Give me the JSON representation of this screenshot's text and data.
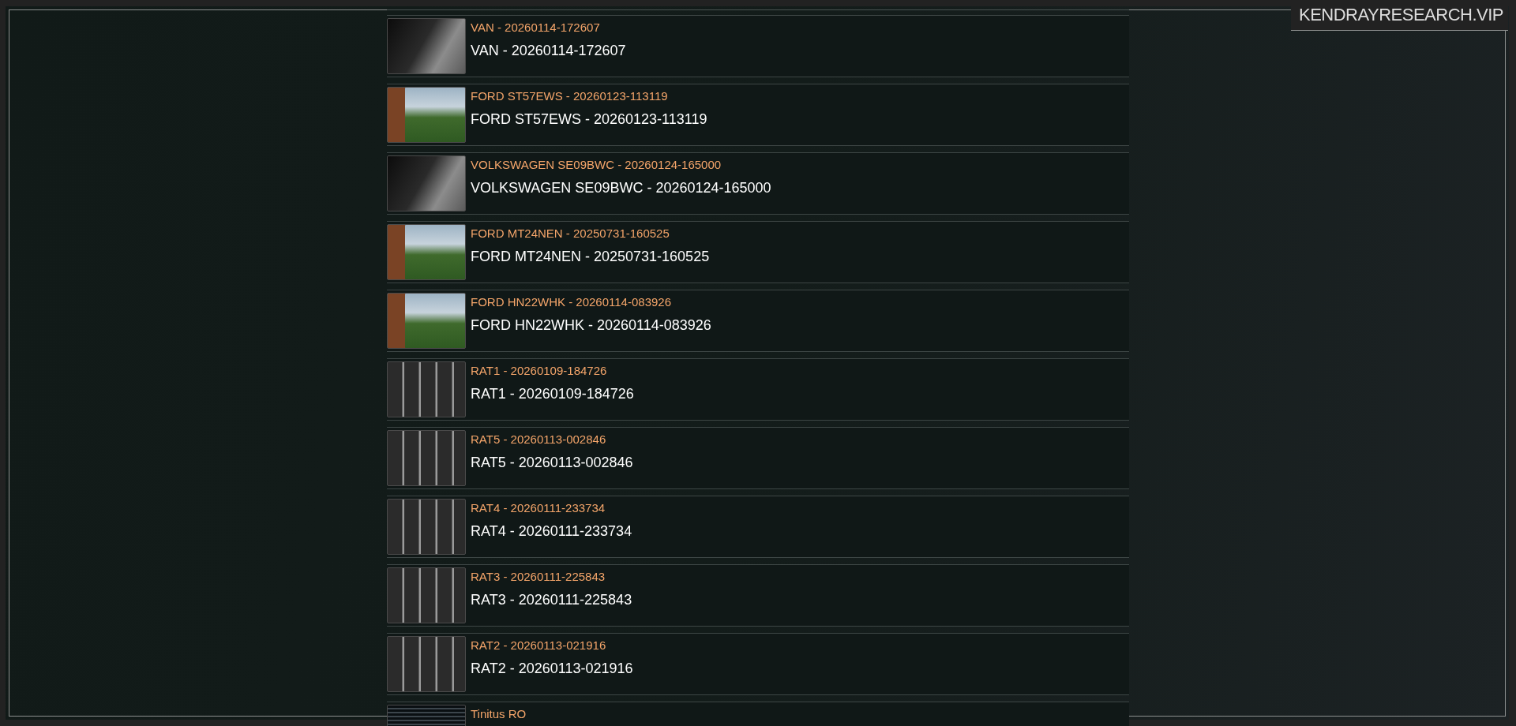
{
  "site_title": "KENDRAYRESEARCH.VIP",
  "recordings": [
    {
      "title": "VAN - 20260114-172607",
      "subtitle": "VAN - 20260114-172607",
      "kind": "night"
    },
    {
      "title": "FORD ST57EWS - 20260123-113119",
      "subtitle": "FORD ST57EWS - 20260123-113119",
      "kind": "day"
    },
    {
      "title": "VOLKSWAGEN SE09BWC - 20260124-165000",
      "subtitle": "VOLKSWAGEN SE09BWC - 20260124-165000",
      "kind": "night"
    },
    {
      "title": "FORD MT24NEN - 20250731-160525",
      "subtitle": "FORD MT24NEN - 20250731-160525",
      "kind": "day"
    },
    {
      "title": "FORD HN22WHK - 20260114-083926",
      "subtitle": "FORD HN22WHK - 20260114-083926",
      "kind": "day"
    },
    {
      "title": "RAT1 - 20260109-184726",
      "subtitle": "RAT1 - 20260109-184726",
      "kind": "cage"
    },
    {
      "title": "RAT5 - 20260113-002846",
      "subtitle": "RAT5 - 20260113-002846",
      "kind": "cage"
    },
    {
      "title": "RAT4 - 20260111-233734",
      "subtitle": "RAT4 - 20260111-233734",
      "kind": "cage"
    },
    {
      "title": "RAT3 - 20260111-225843",
      "subtitle": "RAT3 - 20260111-225843",
      "kind": "cage"
    },
    {
      "title": "RAT2 - 20260113-021916",
      "subtitle": "RAT2 - 20260113-021916",
      "kind": "cage"
    },
    {
      "title": "Tinitus RO",
      "kind": "document"
    }
  ]
}
